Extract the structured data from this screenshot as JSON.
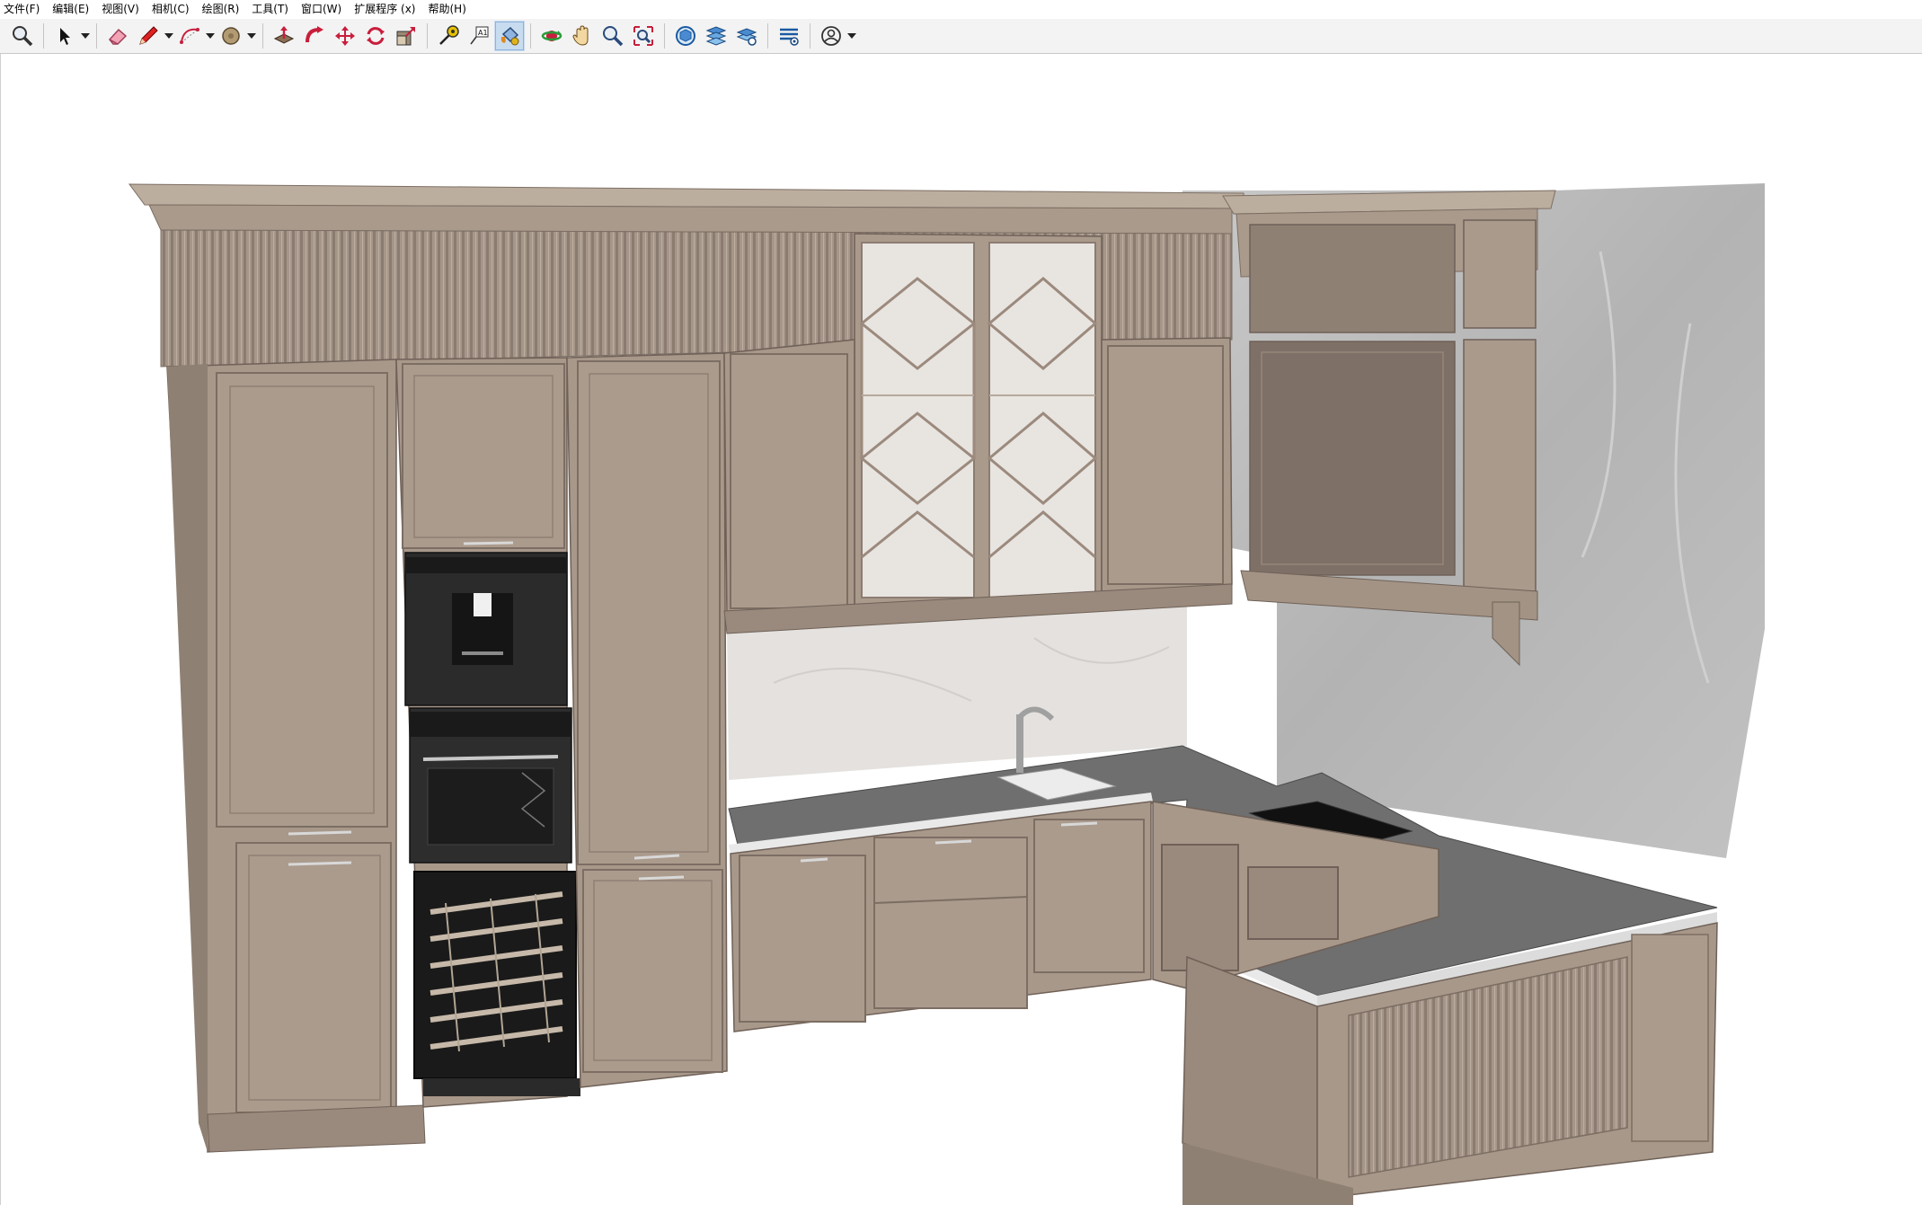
{
  "menubar": {
    "items": [
      {
        "label": "文件(F)"
      },
      {
        "label": "编辑(E)"
      },
      {
        "label": "视图(V)"
      },
      {
        "label": "相机(C)"
      },
      {
        "label": "绘图(R)"
      },
      {
        "label": "工具(T)"
      },
      {
        "label": "窗口(W)"
      },
      {
        "label": "扩展程序 (x)"
      },
      {
        "label": "帮助(H)"
      }
    ]
  },
  "toolbar": {
    "tools": [
      {
        "icon": "zoom-icon"
      },
      {
        "icon": "select-arrow-icon"
      },
      {
        "icon": "eraser-icon"
      },
      {
        "icon": "pencil-line-icon"
      },
      {
        "icon": "arc-icon"
      },
      {
        "icon": "shape-circle-icon"
      },
      {
        "icon": "push-pull-icon"
      },
      {
        "icon": "follow-me-icon"
      },
      {
        "icon": "move-icon"
      },
      {
        "icon": "rotate-icon"
      },
      {
        "icon": "scale-icon"
      },
      {
        "icon": "tape-measure-icon"
      },
      {
        "icon": "text-label-icon"
      },
      {
        "icon": "paint-bucket-icon"
      },
      {
        "icon": "orbit-icon"
      },
      {
        "icon": "pan-hand-icon"
      },
      {
        "icon": "zoom-window-icon"
      },
      {
        "icon": "zoom-extents-icon"
      },
      {
        "icon": "components-icon"
      },
      {
        "icon": "layers-icon"
      },
      {
        "icon": "materials-icon"
      },
      {
        "icon": "styles-icon"
      },
      {
        "icon": "account-icon"
      }
    ],
    "active_tool": "paint-bucket-icon"
  },
  "viewport": {
    "scene": "3d-kitchen-model",
    "colors": {
      "cabinet": "#aa9a8c",
      "cabinet_dark": "#8f8074",
      "countertop": "#6f6f6f",
      "wall": "#bdbdbd",
      "appliance": "#2a2a2a",
      "backsplash": "#e4e1de"
    }
  }
}
